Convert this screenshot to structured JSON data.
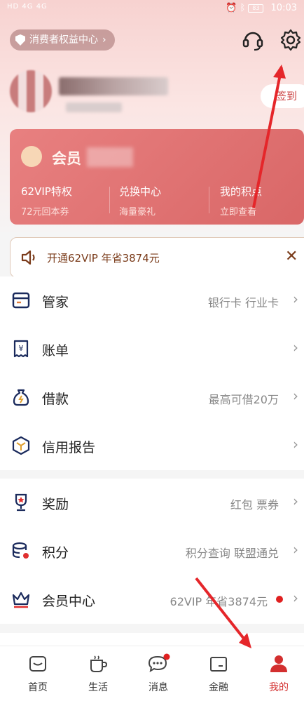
{
  "status_bar": {
    "left_text": "HD 4G 4G",
    "time": "10:03",
    "battery": "83"
  },
  "header": {
    "consumer_center": "消费者权益中心",
    "sign_in": "签到"
  },
  "vip_card": {
    "title": "会员",
    "columns": [
      {
        "title": "62VIP特权",
        "sub": "72元回本券"
      },
      {
        "title": "兑换中心",
        "sub": "海量豪礼"
      },
      {
        "title": "我的积点",
        "sub": "立即查看"
      }
    ]
  },
  "promo": {
    "text": "开通62VIP 年省3874元"
  },
  "menu_group_1": [
    {
      "label": "管家",
      "right": "银行卡 行业卡"
    },
    {
      "label": "账单",
      "right": ""
    },
    {
      "label": "借款",
      "right": "最高可借20万"
    },
    {
      "label": "信用报告",
      "right": ""
    }
  ],
  "menu_group_2": [
    {
      "label": "奖励",
      "right": "红包 票券"
    },
    {
      "label": "积分",
      "right": "积分查询 联盟通兑"
    },
    {
      "label": "会员中心",
      "right": "62VIP 年省3874元"
    }
  ],
  "nav": [
    {
      "label": "首页"
    },
    {
      "label": "生活"
    },
    {
      "label": "消息"
    },
    {
      "label": "金融"
    },
    {
      "label": "我的"
    }
  ],
  "colors": {
    "accent": "#d32f2f",
    "vip_card": "#e07474",
    "promo_text": "#7a3b1a"
  }
}
